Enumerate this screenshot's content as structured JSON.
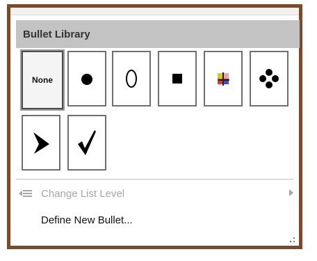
{
  "bullet_library": {
    "title": "Bullet Library",
    "bullets": [
      {
        "name": "none",
        "label": "None",
        "selected": true,
        "icon": "none"
      },
      {
        "name": "filled-circle",
        "icon": "filled-circle-icon",
        "selected": false
      },
      {
        "name": "hollow-circle",
        "icon": "hollow-circle-icon",
        "selected": false
      },
      {
        "name": "filled-square",
        "icon": "filled-square-icon",
        "selected": false
      },
      {
        "name": "four-color-square",
        "icon": "four-color-square-icon",
        "selected": false
      },
      {
        "name": "diamond-dots",
        "icon": "diamond-dots-icon",
        "selected": false
      },
      {
        "name": "arrowhead",
        "icon": "arrowhead-icon",
        "selected": false
      },
      {
        "name": "checkmark",
        "icon": "checkmark-icon",
        "selected": false
      }
    ]
  },
  "menu": {
    "change_list_level": "Change List Level",
    "define_new_bullet": "Define New Bullet..."
  },
  "colors": {
    "frame_border": "#7a4a2c",
    "header_bg": "#c3c3c3",
    "disabled_text": "#a6a6a6"
  }
}
